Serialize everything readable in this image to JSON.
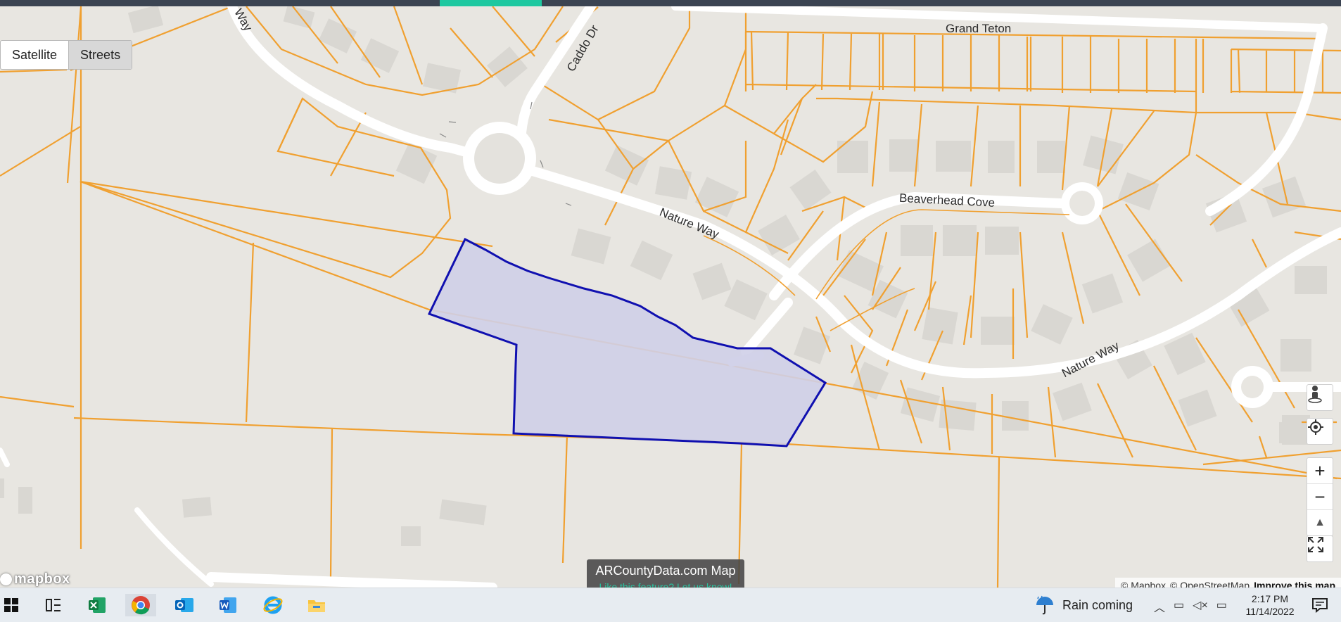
{
  "map": {
    "layer_toggle": {
      "satellite_label": "Satellite",
      "streets_label": "Streets",
      "active": "Streets"
    },
    "street_labels": {
      "grand_teton": "Grand Teton",
      "caddo_dr": "Caddo Dr",
      "way_top": "Way",
      "nature_way_1": "Nature Way",
      "beaverhead_cove": "Beaverhead Cove",
      "nature_way_2": "Nature Way"
    },
    "controls": {
      "street_view_icon": "person-icon",
      "locate_icon": "crosshair-icon",
      "zoom_in_label": "+",
      "zoom_out_label": "−",
      "compass_label": "▲",
      "fullscreen_icon": "fullscreen-icon"
    },
    "logo": "mapbox",
    "attribution": {
      "mapbox": "© Mapbox",
      "osm": "© OpenStreetMap",
      "improve": "Improve this map"
    },
    "banner": {
      "title": "ARCountyData.com Map",
      "link": "Like this feature? Let us know!"
    },
    "colors": {
      "parcel_line": "#f0a030",
      "selected_parcel_fill": "#cfcfe8",
      "selected_parcel_stroke": "#1010b0",
      "road": "#ffffff",
      "building": "#d9d7d2",
      "accent": "#1ec8a0"
    }
  },
  "taskbar": {
    "icons": [
      "windows-start-icon",
      "task-view-icon",
      "excel-icon",
      "chrome-icon",
      "outlook-icon",
      "word-icon",
      "internet-explorer-icon",
      "file-explorer-icon"
    ],
    "weather": {
      "icon": "umbrella-rain-icon",
      "text": "Rain coming"
    },
    "clock": {
      "time": "2:17 PM",
      "date": "11/14/2022"
    }
  }
}
